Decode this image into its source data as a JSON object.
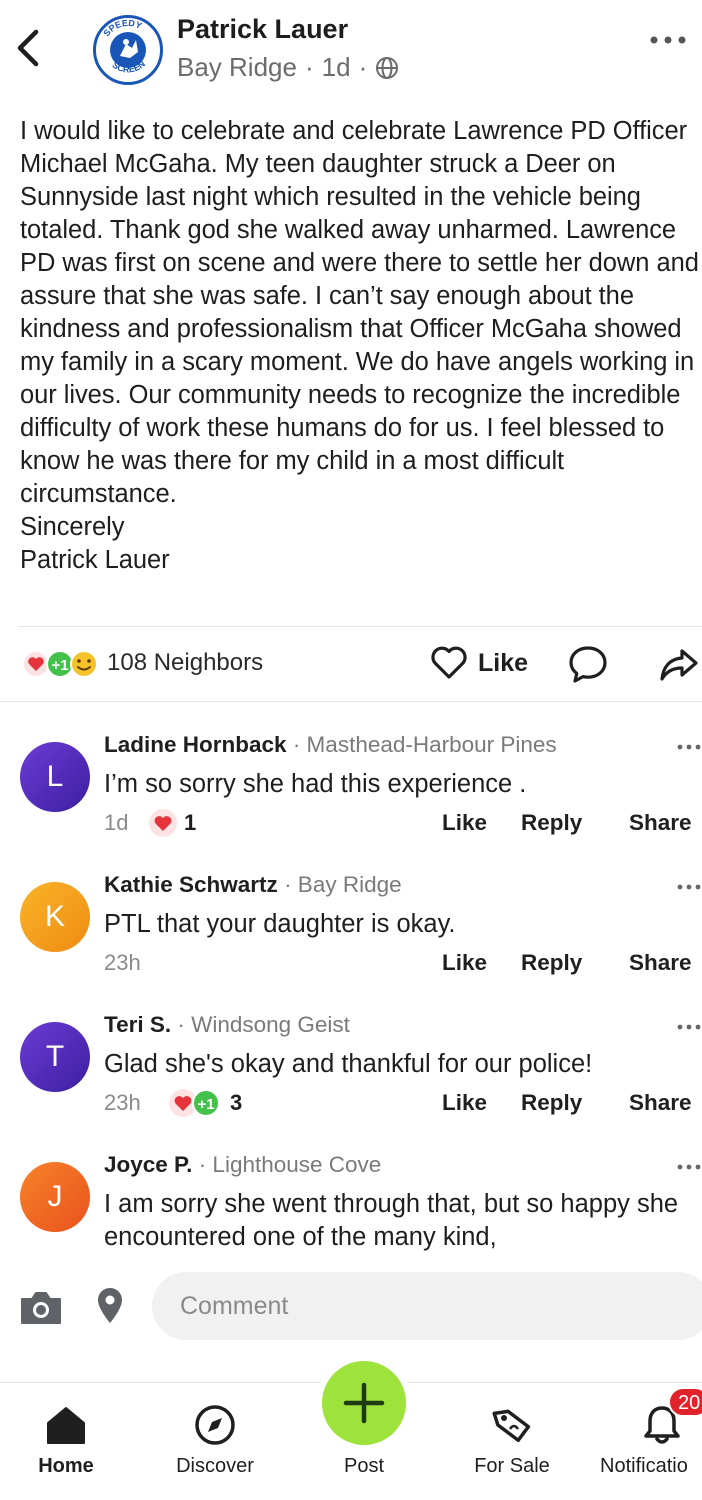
{
  "header": {
    "author_name": "Patrick Lauer",
    "neighborhood": "Bay Ridge",
    "age": "1d",
    "separator": "·",
    "logo_text_top": "SPEEDY",
    "logo_text_bottom": "SCREEN"
  },
  "post": {
    "body": "I would like to celebrate and celebrate Lawrence PD Officer Michael McGaha. My teen daughter struck a Deer on Sunnyside last night which resulted in the vehicle being totaled. Thank god she walked away unharmed. Lawrence PD was first on scene and were there to settle her down and assure that she was safe. I can’t say enough about the kindness and professionalism that Officer McGaha showed my family in a scary moment. We do have angels working in our lives. Our community needs to recognize the incredible difficulty of work these humans do for us. I feel blessed to know he was there for my child in a most difficult circumstance.\nSincerely\nPatrick Lauer",
    "reaction_plus": "+1",
    "neighbors_count": "108 Neighbors",
    "like_label": "Like"
  },
  "comments": [
    {
      "initial": "L",
      "name": "Ladine Hornback",
      "neighborhood": "· Masthead-Harbour Pines",
      "text": "I’m so sorry she had this experience .",
      "time": "1d",
      "reaction_count": "1",
      "like": "Like",
      "reply": "Reply",
      "share": "Share",
      "avatar_color": "#5b2bb5"
    },
    {
      "initial": "K",
      "name": "Kathie Schwartz",
      "neighborhood": "· Bay Ridge",
      "text": "PTL that your daughter is okay.",
      "time": "23h",
      "like": "Like",
      "reply": "Reply",
      "share": "Share",
      "avatar_color": "#f29a1a"
    },
    {
      "initial": "T",
      "name": "Teri S.",
      "neighborhood": "· Windsong Geist",
      "text": "Glad she's okay and thankful for our police!",
      "time": "23h",
      "reaction_plus": "+1",
      "reaction_count": "3",
      "like": "Like",
      "reply": "Reply",
      "share": "Share",
      "avatar_color": "#5b2bb5"
    },
    {
      "initial": "J",
      "name": "Joyce P.",
      "neighborhood": "· Lighthouse Cove",
      "text": "I am sorry she went through that, but so happy she encountered one of the many kind,",
      "avatar_color": "#f06a1c"
    }
  ],
  "compose": {
    "placeholder": "Comment"
  },
  "nav": {
    "home": "Home",
    "discover": "Discover",
    "post": "Post",
    "for_sale": "For Sale",
    "notifications": "Notificatio",
    "notif_badge": "20"
  },
  "colors": {
    "brand_green": "#9ee23c",
    "badge_red": "#e0232a",
    "heart_red": "#e5343c",
    "plus_one_green": "#43c14a",
    "smile_yellow": "#f6c22b"
  }
}
